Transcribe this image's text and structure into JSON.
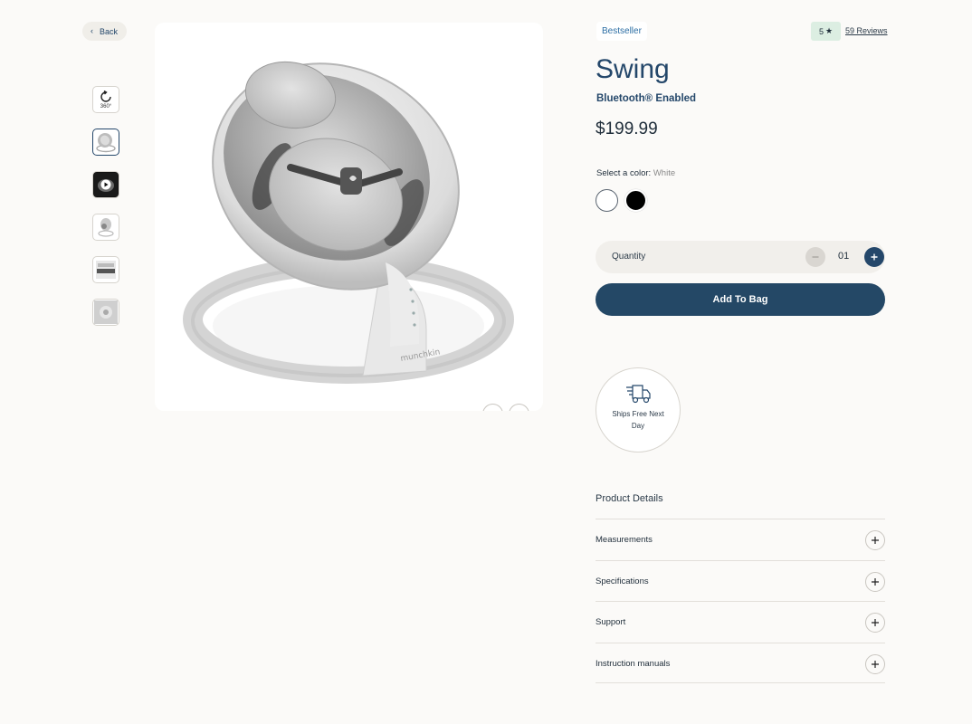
{
  "back": {
    "label": "Back"
  },
  "gallery": {
    "thumb_360_label": "360°",
    "thumbnails": [
      "360-view",
      "front-white",
      "video",
      "side-view",
      "packaging",
      "detail-view"
    ],
    "active_index": 1
  },
  "product": {
    "badge": "Bestseller",
    "rating": "5",
    "reviews_link": "59 Reviews",
    "title": "Swing",
    "subtitle": "Bluetooth® Enabled",
    "price": "$199.99",
    "brand_mark": "munchkin"
  },
  "color": {
    "label": "Select a color:",
    "selected": "White",
    "options": [
      "#ffffff",
      "#000000"
    ]
  },
  "quantity": {
    "label": "Quantity",
    "value": "01"
  },
  "cart": {
    "add_label": "Add To Bag"
  },
  "shipping": {
    "text": "Ships Free Next Day"
  },
  "details": {
    "title": "Product Details",
    "sections": [
      "Measurements",
      "Specifications",
      "Support",
      "Instruction manuals"
    ]
  },
  "colors": {
    "accent": "#244866",
    "link": "#2c6ea4",
    "rating_bg": "#dceee2",
    "page_bg": "#fbfaf8"
  }
}
